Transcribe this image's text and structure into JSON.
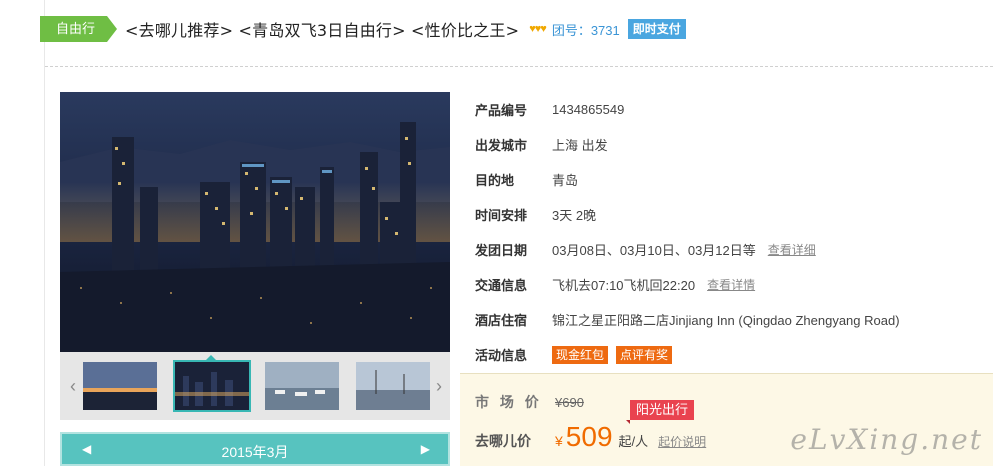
{
  "header": {
    "tag": "自由行",
    "title": "<去哪儿推荐> <青岛双飞3日自由行> <性价比之王>",
    "stars": "♥♥♥",
    "team_no": "团号：3731",
    "pay_badge": "即时支付"
  },
  "gallery": {
    "main_image": "qingdao-night-skyline",
    "thumbnails": [
      "sunset-harbor",
      "night-skyline",
      "marina-boats",
      "sailboats-dusk"
    ],
    "active_thumb": 1,
    "prev_icon": "‹",
    "next_icon": "›"
  },
  "calendar": {
    "month": "2015年3月",
    "prev_icon": "◀",
    "next_icon": "▶"
  },
  "info": {
    "product_no_label": "产品编号",
    "product_no": "1434865549",
    "departure_label": "出发城市",
    "departure": "上海 出发",
    "destination_label": "目的地",
    "destination": "青岛",
    "schedule_label": "时间安排",
    "schedule": "3天 2晚",
    "dates_label": "发团日期",
    "dates": "03月08日、03月10日、03月12日等",
    "dates_link": "查看详细",
    "traffic_label": "交通信息",
    "traffic": "飞机去07:10飞机回22:20",
    "traffic_link": "查看详情",
    "hotel_label": "酒店住宿",
    "hotel": "锦江之星正阳路二店Jinjiang Inn (Qingdao Zhengyang Road)",
    "activity_label": "活动信息",
    "promo1": "现金红包",
    "promo2": "点评有奖"
  },
  "price": {
    "market_label": "市 场 价",
    "market_price": "¥690",
    "ribbon": "阳光出行",
    "qunar_label": "去哪儿价",
    "yen": "¥",
    "price": "509",
    "unit": "起",
    "per": "/人",
    "link": "起价说明"
  },
  "watermark": "eLvXing.net",
  "colors": {
    "tag_green": "#6fbe44",
    "pay_blue": "#4aa6e0",
    "teal": "#57c3bf",
    "promo_orange": "#ee6a11",
    "price_orange": "#f06b00",
    "ribbon_red": "#e9434f"
  }
}
